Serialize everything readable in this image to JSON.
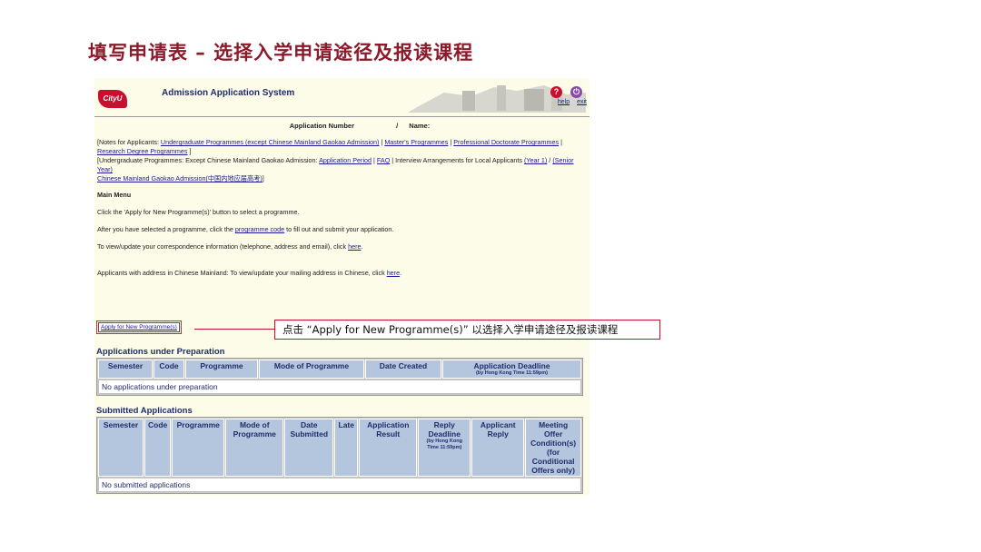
{
  "slide": {
    "title": "填写申请表 – 选择入学申请途径及报读课程",
    "callout": "点击 “Apply for New Programme(s)” 以选择入学申请途径及报读课程"
  },
  "header": {
    "logo": "CityU",
    "system_title": "Admission Application System",
    "help": "help",
    "exit": "exit"
  },
  "app_info": {
    "application_number": "Application Number",
    "separator": "/",
    "name": "Name:"
  },
  "notes": {
    "n1_prefix": "[Notes for Applicants: ",
    "ug_link": "Undergraduate Programmes (except Chinese Mainland Gaokao Admission)",
    "sep1": " | ",
    "masters_link": "Master's Programmes",
    "sep2": " | ",
    "profdoc_link": "Professional Doctorate Programmes",
    "sep3": " | ",
    "research_link": "Research Degree Programmes",
    "n1_suffix": " ]",
    "n2_prefix": "[Undergraduate Programmes: Except Chinese Mainland Gaokao Admission: ",
    "period_link": "Application Period",
    "sep4": " | ",
    "faq_link": "FAQ",
    "n2_mid": " | Interview Arrangements for Local Applicants ",
    "year1_link": "(Year 1)",
    "sep5": " / ",
    "senior_link": "(Senior Year)",
    "gaokao_link": "Chinese Mainland Gaokao Admission(中国内地应届高考)",
    "n3_suffix": "]"
  },
  "main_menu": {
    "title": "Main Menu",
    "line1": "Click the 'Apply for New Programme(s)' button to select a programme.",
    "line2_prefix": "After you have selected a programme, click the ",
    "line2_link": "programme code",
    "line2_suffix": " to fill out and submit your application.",
    "line3_prefix": "To view/update your correspondence information (telephone, address and email), click ",
    "line3_link": "here",
    "line3_suffix": ".",
    "line4_prefix": "Applicants with address in Chinese Mainland: To view/update your mailing address in Chinese, click ",
    "line4_link": "here",
    "line4_suffix": ".",
    "apply_button": "Apply for New Programme(s)"
  },
  "under_prep": {
    "title": "Applications under Preparation",
    "headers": [
      "Semester",
      "Code",
      "Programme",
      "Mode of Programme",
      "Date Created",
      "Application Deadline"
    ],
    "deadline_note": "(by Hong Kong Time 11:59pm)",
    "empty": "No applications under preparation"
  },
  "submitted": {
    "title": "Submitted Applications",
    "headers": [
      "Semester",
      "Code",
      "Programme",
      "Mode of Programme",
      "Date Submitted",
      "Late",
      "Application Result",
      "Reply Deadline",
      "Applicant Reply",
      "Meeting Offer Condition(s) (for Conditional Offers only)"
    ],
    "reply_note": "(by Hong Kong Time 11:59pm)",
    "empty": "No submitted applications"
  }
}
